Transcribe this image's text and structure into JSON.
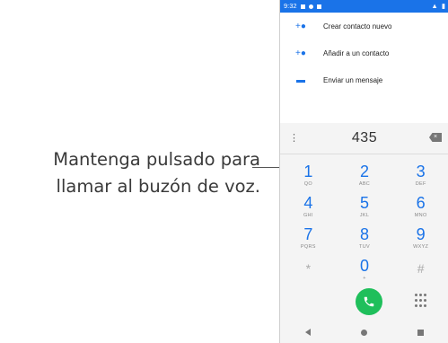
{
  "callout": {
    "line1": "Mantenga pulsado para",
    "line2": "llamar al buzón de voz."
  },
  "statusbar": {
    "time": "9:32"
  },
  "menu": [
    {
      "icon": "add-contact-icon",
      "label": "Crear contacto nuevo"
    },
    {
      "icon": "add-to-contact-icon",
      "label": "Añadir a un contacto"
    },
    {
      "icon": "message-icon",
      "label": "Enviar un mensaje"
    }
  ],
  "dialer": {
    "number": "435",
    "keys": [
      {
        "digit": "1",
        "letters": "QO"
      },
      {
        "digit": "2",
        "letters": "ABC"
      },
      {
        "digit": "3",
        "letters": "DEF"
      },
      {
        "digit": "4",
        "letters": "GHI"
      },
      {
        "digit": "5",
        "letters": "JKL"
      },
      {
        "digit": "6",
        "letters": "MNO"
      },
      {
        "digit": "7",
        "letters": "PQRS"
      },
      {
        "digit": "8",
        "letters": "TUV"
      },
      {
        "digit": "9",
        "letters": "WXYZ"
      },
      {
        "digit": "*",
        "letters": ""
      },
      {
        "digit": "0",
        "letters": "+"
      },
      {
        "digit": "#",
        "letters": ""
      }
    ]
  },
  "colors": {
    "accent": "#1a73e8",
    "call": "#1fbf5b"
  }
}
